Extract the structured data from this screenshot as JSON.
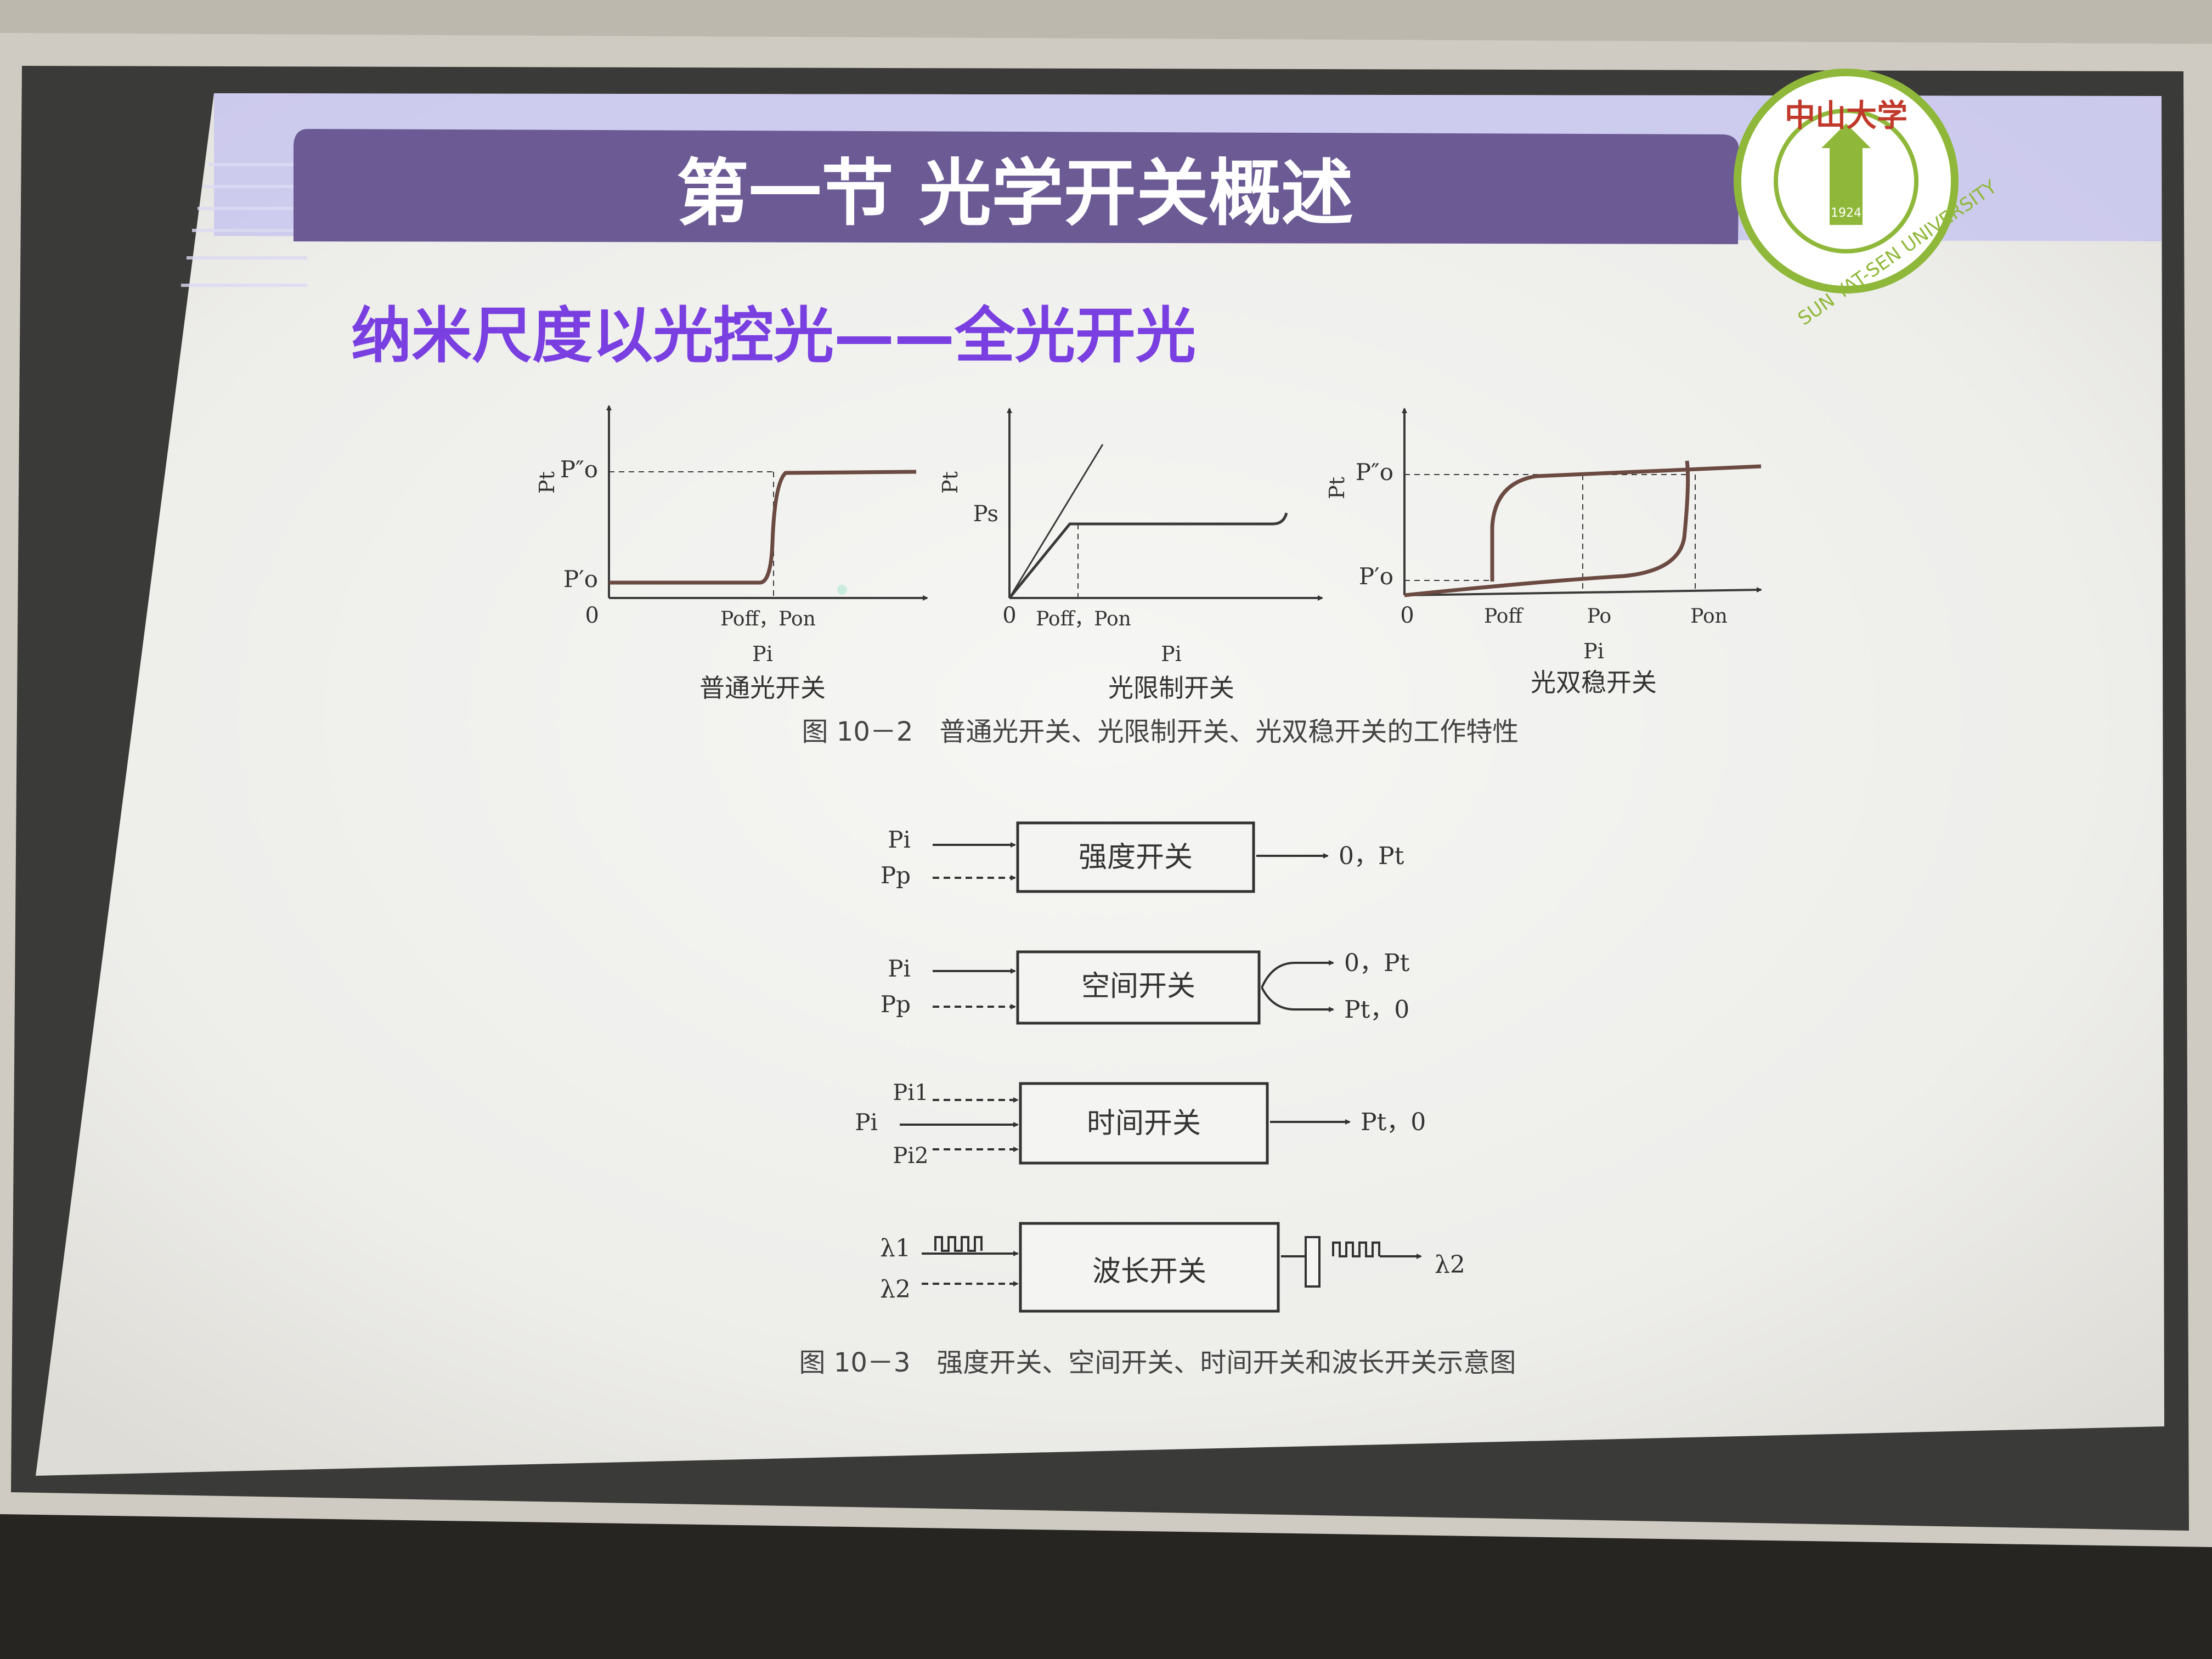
{
  "slide": {
    "section_title": "第一节 光学开关概述",
    "subtitle": "纳米尺度以光控光——全光开光",
    "logo": {
      "text_cn": "中山大学",
      "text_en": "SUN YAT-SEN UNIVERSITY",
      "year": "1924"
    },
    "colors": {
      "title_bar": "#6b5a94",
      "subtitle": "#7a3fe0",
      "accent_band": "#c8c6ee",
      "logo_green": "#8fb83a",
      "logo_red": "#c0392b"
    }
  },
  "figure_10_2": {
    "caption": "图 10－2　普通光开关、光限制开关、光双稳开关的工作特性",
    "graphs": [
      {
        "name": "普通光开关",
        "y_label": "Pt",
        "x_label": "Pi",
        "labels": [
          "P″o",
          "P′o",
          "0",
          "Poff，Pon"
        ]
      },
      {
        "name": "光限制开关",
        "y_label": "Pt",
        "x_label": "Pi",
        "labels": [
          "Ps",
          "0",
          "Poff，Pon"
        ]
      },
      {
        "name": "光双稳开关",
        "y_label": "Pt",
        "x_label": "Pi",
        "labels": [
          "P″o",
          "P′o",
          "0",
          "Poff",
          "Po",
          "Pon"
        ]
      }
    ]
  },
  "figure_10_3": {
    "caption": "图 10－3　强度开关、空间开关、时间开关和波长开关示意图",
    "blocks": [
      {
        "label": "强度开关",
        "inputs": [
          "Pi",
          "Pp"
        ],
        "outputs": [
          "0，Pt"
        ]
      },
      {
        "label": "空间开关",
        "inputs": [
          "Pi",
          "Pp"
        ],
        "outputs": [
          "0，Pt",
          "Pt，0"
        ]
      },
      {
        "label": "时间开关",
        "inputs": [
          "Pi1",
          "Pi",
          "Pi2"
        ],
        "outputs": [
          "Pt，0"
        ]
      },
      {
        "label": "波长开关",
        "inputs": [
          "λ1",
          "λ2"
        ],
        "outputs": [
          "λ2"
        ]
      }
    ]
  }
}
